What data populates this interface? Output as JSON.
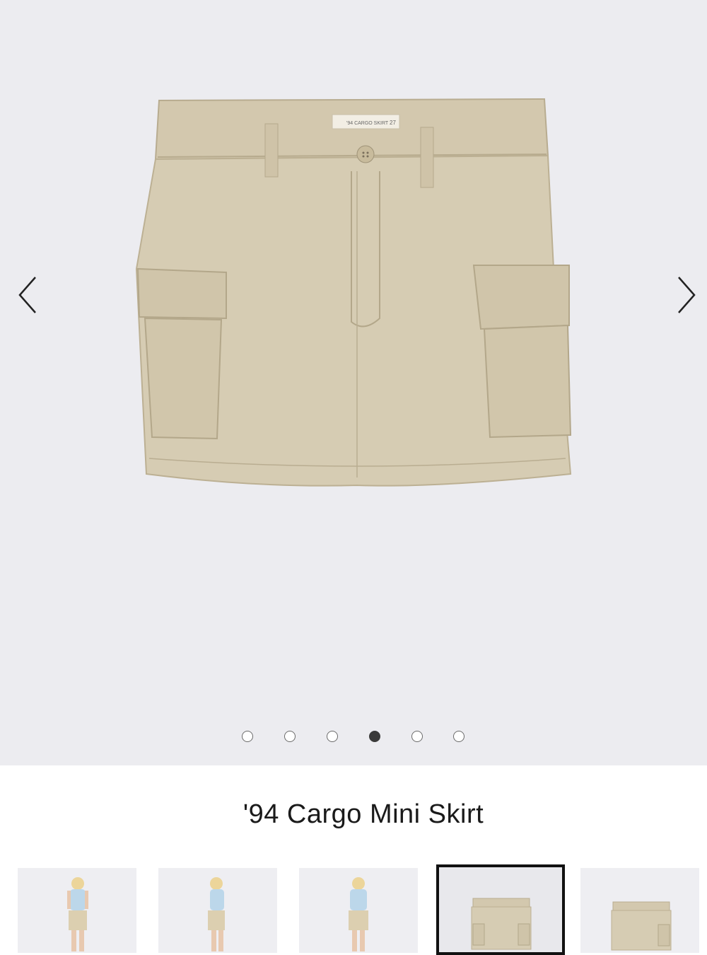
{
  "product": {
    "title": "'94 Cargo Mini Skirt",
    "label_text": "'94 CARGO SKIRT",
    "label_size": "27"
  },
  "carousel": {
    "prev_icon": "chevron-left-icon",
    "next_icon": "chevron-right-icon",
    "slide_count": 6,
    "active_index": 3
  },
  "thumbnails": [
    {
      "view": "model-front"
    },
    {
      "view": "model-side"
    },
    {
      "view": "model-back"
    },
    {
      "view": "flat-front",
      "selected": true
    },
    {
      "view": "flat-back"
    }
  ],
  "colors": {
    "background": "#ececf0",
    "skirt": "#d3c8ae",
    "active_dot": "#3a3a3a"
  }
}
